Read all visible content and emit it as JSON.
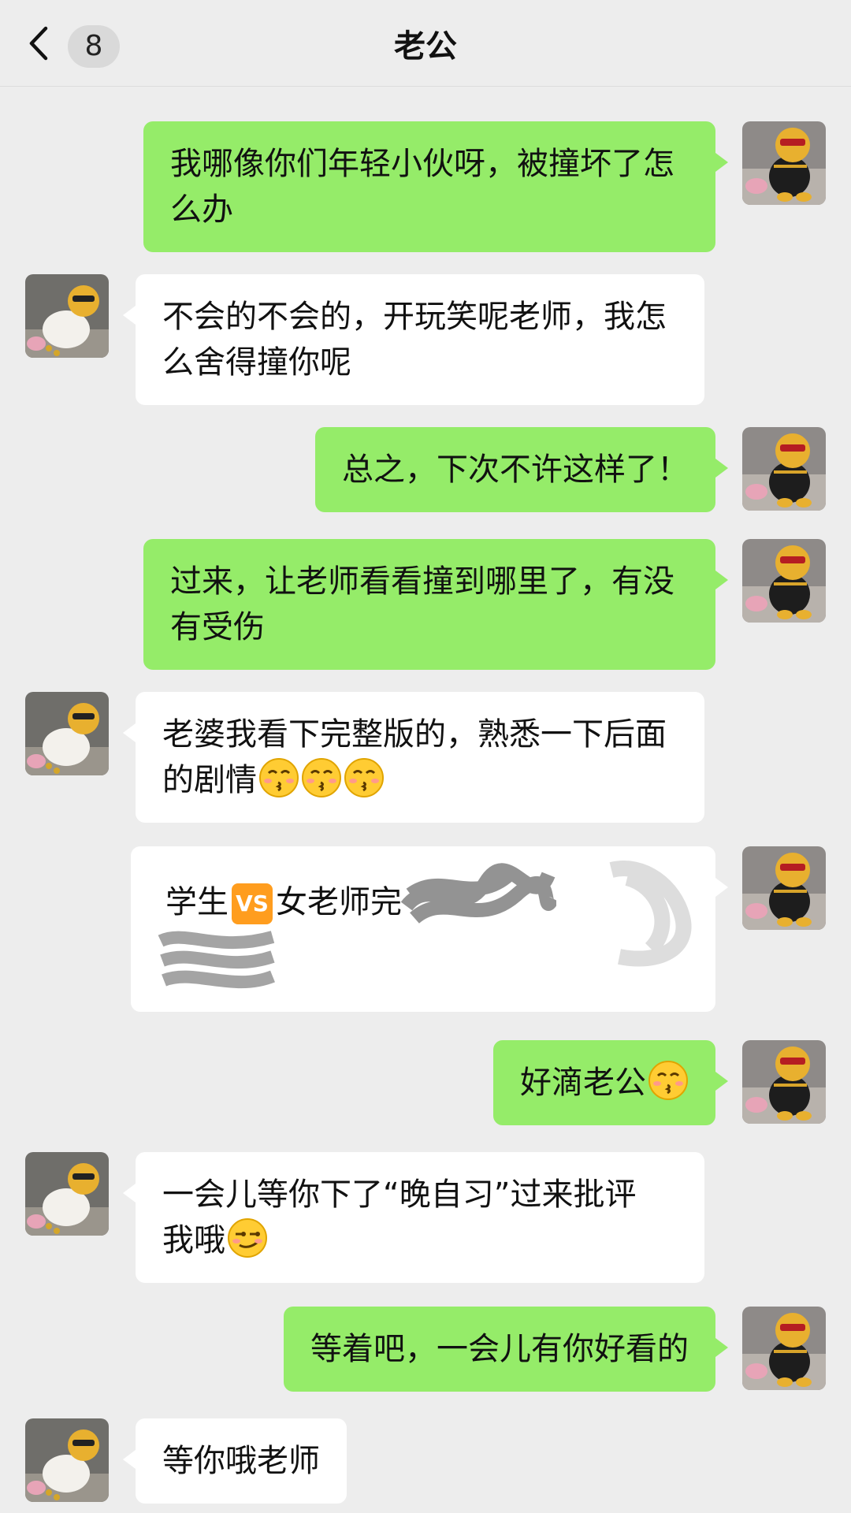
{
  "header": {
    "title": "老公",
    "unread_count": "8"
  },
  "messages": [
    {
      "from": "me",
      "text": "我哪像你们年轻小伙呀，被撞坏了怎么办"
    },
    {
      "from": "them",
      "text": "不会的不会的，开玩笑呢老师，我怎么舍得撞你呢"
    },
    {
      "from": "me",
      "text": "总之，下次不许这样了！"
    },
    {
      "from": "me",
      "text": "过来，让老师看看撞到哪里了，有没有受伤"
    },
    {
      "from": "them",
      "text": "老婆我看下完整版的，熟悉一下后面的剧情",
      "emoji": "kiss-face-emoji ×3"
    },
    {
      "from": "me",
      "type": "link-card",
      "text_a": "学生",
      "badge": "VS",
      "text_b": "女老师完"
    },
    {
      "from": "me",
      "text": "好滴老公",
      "emoji": "kiss-face-emoji"
    },
    {
      "from": "them",
      "text_a": "一会儿等你下了“晚自习”过来批评",
      "text_b": "我哦",
      "emoji": "smirk-face-emoji"
    },
    {
      "from": "me",
      "text": "等着吧，一会儿有你好看的"
    },
    {
      "from": "them",
      "text": "等你哦老师"
    }
  ],
  "colors": {
    "sent_bubble": "#95ec69",
    "received_bubble": "#ffffff",
    "background": "#ededed"
  }
}
